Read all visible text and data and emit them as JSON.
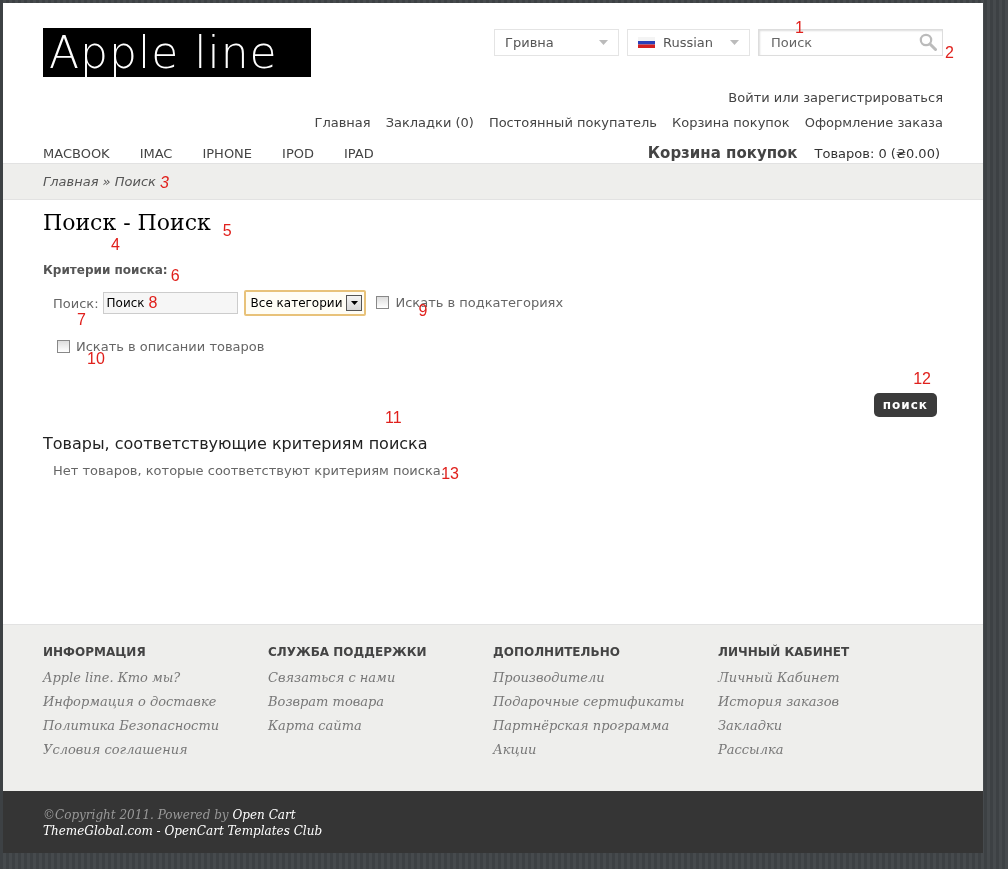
{
  "header": {
    "logo": "Apple line",
    "currency": {
      "value": "Гривна"
    },
    "language": {
      "value": "Russian"
    },
    "search": {
      "placeholder": "Поиск",
      "marker": "1",
      "icon_marker": "2"
    },
    "account_link": "Войти или зарегистрироваться",
    "top_links": [
      "Главная",
      "Закладки (0)",
      "Постоянный покупатель",
      "Корзина покупок",
      "Оформление заказа"
    ],
    "categories": [
      "MACBOOK",
      "IMAC",
      "IPHONE",
      "IPOD",
      "IPAD"
    ],
    "cart": {
      "title": "Корзина покупок",
      "summary": "Товаров: 0 (₴0.00)"
    }
  },
  "breadcrumb": {
    "items": [
      "Главная",
      "Поиск"
    ],
    "separator": "»",
    "marker": "3"
  },
  "title": {
    "text": "Поиск - Поиск",
    "dash_marker": "4",
    "marker": "5"
  },
  "criteria": {
    "heading": "Критерии поиска:",
    "marker": "6",
    "search_label": "Поиск:",
    "label_marker": "7",
    "search_value": "Поиск",
    "value_marker": "8",
    "category": "Все категории",
    "subcategories": {
      "label": "Искать в подкатегориях",
      "checked": false,
      "marker": "9"
    },
    "description": {
      "label": "Искать в описании товаров",
      "checked": false,
      "marker": "10"
    },
    "button": "поиск",
    "button_marker": "12"
  },
  "results": {
    "heading": "Товары, соответствующие критериям поиска",
    "heading_marker": "11",
    "empty": "Нет товаров, которые соответствуют критериям поиска.",
    "empty_marker": "13"
  },
  "footer": {
    "columns": [
      {
        "title": "ИНФОРМАЦИЯ",
        "links": [
          "Apple line. Кто мы?",
          "Информация о доставке",
          "Политика Безопасности",
          "Условия соглашения"
        ]
      },
      {
        "title": "СЛУЖБА ПОДДЕРЖКИ",
        "links": [
          "Связаться с нами",
          "Возврат товара",
          "Карта сайта"
        ]
      },
      {
        "title": "ДОПОЛНИТЕЛЬНО",
        "links": [
          "Производители",
          "Подарочные сертификаты",
          "Партнёрская программа",
          "Акции"
        ]
      },
      {
        "title": "ЛИЧНЫЙ КАБИНЕТ",
        "links": [
          "Личный Кабинет",
          "История заказов",
          "Закладки",
          "Рассылка"
        ]
      }
    ],
    "copyright": "©Copyright 2011. Powered by",
    "powered_link": "Open Cart",
    "theme_link": "ThemeGlobal.com - OpenCart Templates Club"
  }
}
